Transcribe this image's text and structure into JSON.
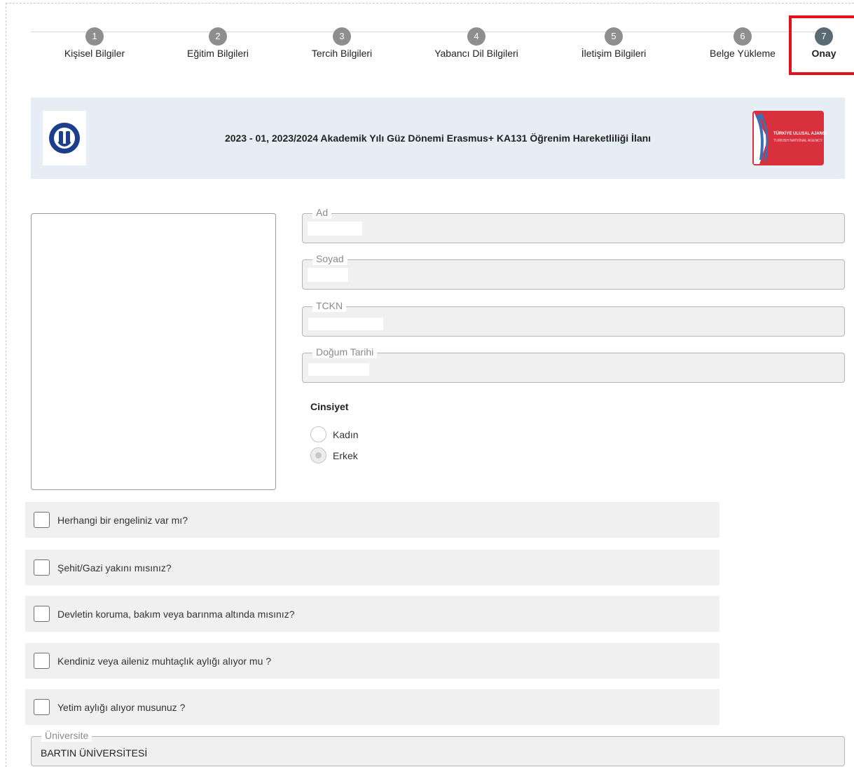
{
  "stepper": {
    "steps": [
      {
        "number": "1",
        "label": "Kişisel Bilgiler"
      },
      {
        "number": "2",
        "label": "Eğitim Bilgileri"
      },
      {
        "number": "3",
        "label": "Tercih Bilgileri"
      },
      {
        "number": "4",
        "label": "Yabancı Dil Bilgileri"
      },
      {
        "number": "5",
        "label": "İletişim Bilgileri"
      },
      {
        "number": "6",
        "label": "Belge Yükleme"
      },
      {
        "number": "7",
        "label": "Onay"
      }
    ],
    "active_step": 7
  },
  "banner": {
    "title": "2023 - 01, 2023/2024 Akademik Yılı Güz Dönemi Erasmus+ KA131 Öğrenim Hareketliliği İlanı",
    "left_logo": "university-seal-icon",
    "right_logo": "national-agency-logo",
    "right_logo_text_1": "TÜRKİYE ULUSAL AJANSI",
    "right_logo_text_2": "TURKISH NATIONAL AGENCY"
  },
  "form": {
    "ad_label": "Ad",
    "ad_value": "",
    "soyad_label": "Soyad",
    "soyad_value": "",
    "tckn_label": "TCKN",
    "tckn_value": "",
    "dogum_label": "Doğum Tarihi",
    "dogum_value": "",
    "gender_title": "Cinsiyet",
    "gender_options": [
      {
        "label": "Kadın",
        "selected": false
      },
      {
        "label": "Erkek",
        "selected": true
      }
    ],
    "questions": [
      {
        "label": "Herhangi bir engeliniz var mı?",
        "checked": false
      },
      {
        "label": "Şehit/Gazi yakını mısınız?",
        "checked": false
      },
      {
        "label": "Devletin koruma, bakım veya barınma altında mısınız?",
        "checked": false
      },
      {
        "label": "Kendiniz veya aileniz muhtaçlık aylığı alıyor mu ?",
        "checked": false
      },
      {
        "label": "Yetim aylığı alıyor musunuz ?",
        "checked": false
      }
    ],
    "universite_label": "Üniversite",
    "universite_value": "BARTIN ÜNİVERSİTESİ"
  },
  "colors": {
    "step_inactive": "#8e8e8e",
    "step_active": "#5a6b74",
    "highlight": "#e3121a",
    "banner_bg": "#e7edf4",
    "agency_red": "#d9303d",
    "seal_blue": "#1d3e8a"
  }
}
